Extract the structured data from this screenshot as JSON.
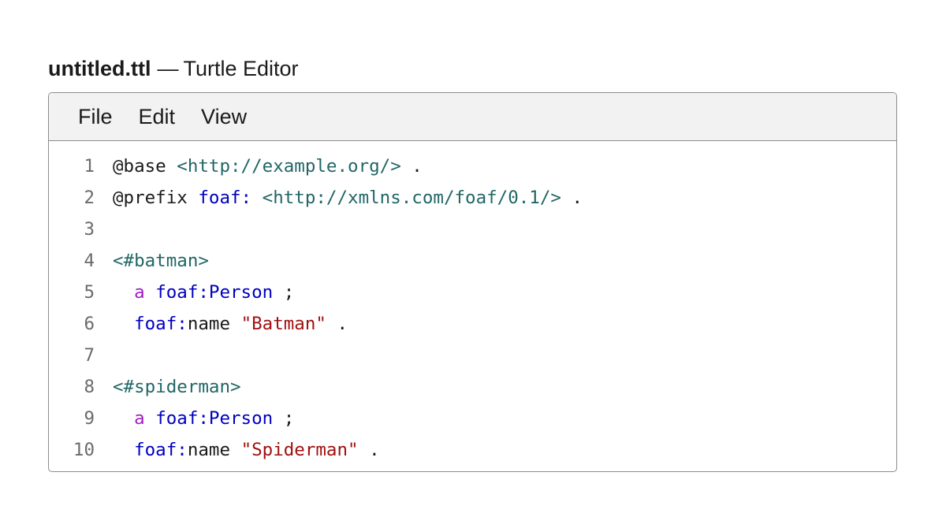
{
  "window": {
    "filename": "untitled.ttl",
    "separator": "—",
    "app_name": "Turtle Editor"
  },
  "menubar": {
    "file": "File",
    "edit": "Edit",
    "view": "View"
  },
  "lines": [
    {
      "number": "1",
      "tokens": [
        {
          "text": "@base",
          "type": "directive"
        },
        {
          "text": " ",
          "type": "plain"
        },
        {
          "text": "<http://example.org/>",
          "type": "iri"
        },
        {
          "text": " .",
          "type": "punct"
        }
      ]
    },
    {
      "number": "2",
      "tokens": [
        {
          "text": "@prefix",
          "type": "directive"
        },
        {
          "text": " ",
          "type": "plain"
        },
        {
          "text": "foaf:",
          "type": "prefix"
        },
        {
          "text": " ",
          "type": "plain"
        },
        {
          "text": "<http://xmlns.com/foaf/0.1/>",
          "type": "iri"
        },
        {
          "text": " .",
          "type": "punct"
        }
      ]
    },
    {
      "number": "3",
      "tokens": []
    },
    {
      "number": "4",
      "tokens": [
        {
          "text": "<#batman>",
          "type": "iri"
        }
      ]
    },
    {
      "number": "5",
      "tokens": [
        {
          "text": "  ",
          "type": "plain"
        },
        {
          "text": "a",
          "type": "keyword"
        },
        {
          "text": " ",
          "type": "plain"
        },
        {
          "text": "foaf:",
          "type": "prefix"
        },
        {
          "text": "Person",
          "type": "prefix"
        },
        {
          "text": " ;",
          "type": "punct"
        }
      ]
    },
    {
      "number": "6",
      "tokens": [
        {
          "text": "  ",
          "type": "plain"
        },
        {
          "text": "foaf:",
          "type": "prefix"
        },
        {
          "text": "name",
          "type": "plain"
        },
        {
          "text": " ",
          "type": "plain"
        },
        {
          "text": "\"Batman\"",
          "type": "string"
        },
        {
          "text": " .",
          "type": "punct"
        }
      ]
    },
    {
      "number": "7",
      "tokens": []
    },
    {
      "number": "8",
      "tokens": [
        {
          "text": "<#spiderman>",
          "type": "iri"
        }
      ]
    },
    {
      "number": "9",
      "tokens": [
        {
          "text": "  ",
          "type": "plain"
        },
        {
          "text": "a",
          "type": "keyword"
        },
        {
          "text": " ",
          "type": "plain"
        },
        {
          "text": "foaf:",
          "type": "prefix"
        },
        {
          "text": "Person",
          "type": "prefix"
        },
        {
          "text": " ;",
          "type": "punct"
        }
      ]
    },
    {
      "number": "10",
      "tokens": [
        {
          "text": "  ",
          "type": "plain"
        },
        {
          "text": "foaf:",
          "type": "prefix"
        },
        {
          "text": "name",
          "type": "plain"
        },
        {
          "text": " ",
          "type": "plain"
        },
        {
          "text": "\"Spiderman\"",
          "type": "string"
        },
        {
          "text": " .",
          "type": "punct"
        }
      ]
    }
  ],
  "colors": {
    "iri": "#226666",
    "prefix": "#0000c0",
    "keyword": "#a020c0",
    "string": "#a01010",
    "line_number": "#6b6b6b",
    "menubar_bg": "#f2f2f2",
    "border": "#8c8c8c"
  }
}
